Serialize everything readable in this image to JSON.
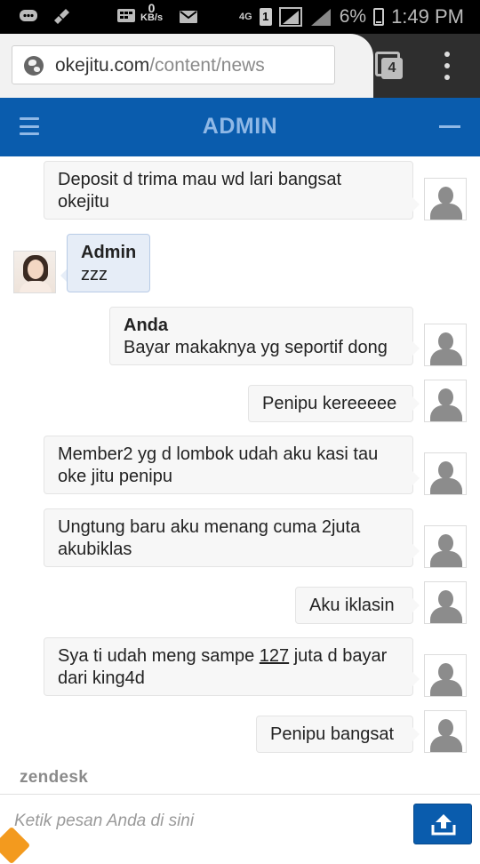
{
  "status_bar": {
    "speed_value": "0",
    "speed_unit": "KB/s",
    "network": "4G",
    "sim": "1",
    "battery": "6%",
    "time": "1:49 PM"
  },
  "browser": {
    "url_domain": "okejitu.com",
    "url_path": "/content/news",
    "tab_count": "4"
  },
  "chat_header": {
    "title": "ADMIN"
  },
  "messages": [
    {
      "side": "right",
      "sender": "",
      "line1": "Deposit d trima mau wd lari bangsat",
      "line2": "okejitu"
    },
    {
      "side": "left",
      "sender": "Admin",
      "line1": "zzz",
      "line2": ""
    },
    {
      "side": "right",
      "sender": "Anda",
      "line1": "Bayar makaknya yg seportif dong",
      "line2": ""
    },
    {
      "side": "right",
      "sender": "",
      "line1": "Penipu kereeeee",
      "line2": ""
    },
    {
      "side": "right",
      "sender": "",
      "line1": "Member2 yg d lombok udah aku kasi tau",
      "line2": "oke jitu penipu"
    },
    {
      "side": "right",
      "sender": "",
      "line1": "Ungtung baru aku menang cuma 2juta",
      "line2": "akubiklas"
    },
    {
      "side": "right",
      "sender": "",
      "line1": "Aku iklasin",
      "line2": ""
    },
    {
      "side": "right",
      "sender": "",
      "line1a": "Sya ti udah meng sampe ",
      "line1b": "127",
      "line1c": " juta d bayar",
      "line2": "dari king4d"
    },
    {
      "side": "right",
      "sender": "",
      "line1": "Penipu bangsat",
      "line2": ""
    }
  ],
  "brand": "zendesk",
  "composer": {
    "placeholder": "Ketik pesan Anda di sini"
  }
}
